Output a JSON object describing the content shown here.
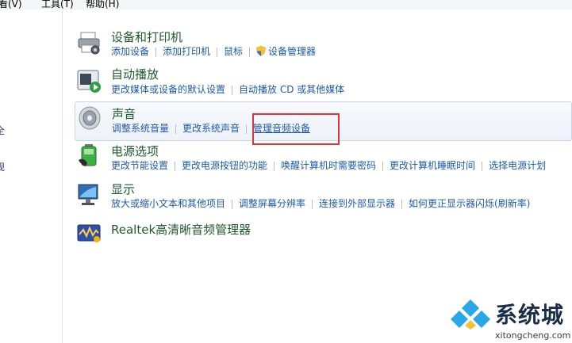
{
  "menubar": {
    "items": [
      "查看(V)",
      "工具(T)",
      "帮助(H)"
    ]
  },
  "left_pane": {
    "fragments": [
      "全",
      "规"
    ]
  },
  "categories": [
    {
      "title": "设备和打印机",
      "icon": "devices-printer-icon",
      "links": [
        "添加设备",
        "添加打印机",
        "鼠标",
        "设备管理器"
      ]
    },
    {
      "title": "自动播放",
      "icon": "autoplay-icon",
      "links": [
        "更改媒体或设备的默认设置",
        "自动播放 CD 或其他媒体"
      ]
    },
    {
      "title": "声音",
      "icon": "speaker-icon",
      "links": [
        "调整系统音量",
        "更改系统声音",
        "管理音频设备"
      ]
    },
    {
      "title": "电源选项",
      "icon": "battery-icon",
      "links": [
        "更改节能设置",
        "更改电源按钮的功能",
        "唤醒计算机时需要密码",
        "更改计算机睡眠时间",
        "选择电源计划"
      ]
    },
    {
      "title": "显示",
      "icon": "monitor-icon",
      "links": [
        "放大或缩小文本和其他项目",
        "调整屏幕分辨率",
        "连接到外部显示器",
        "如何更正显示器闪烁(刷新率)"
      ]
    },
    {
      "title": "Realtek高清晰音频管理器",
      "icon": "realtek-audio-icon",
      "links": []
    }
  ],
  "watermark": {
    "brand": "系统城",
    "url": "xitongcheng.com"
  },
  "colors": {
    "link": "#1e5aa8",
    "title": "#1e5a2f",
    "highlight_box": "#e0343a"
  }
}
